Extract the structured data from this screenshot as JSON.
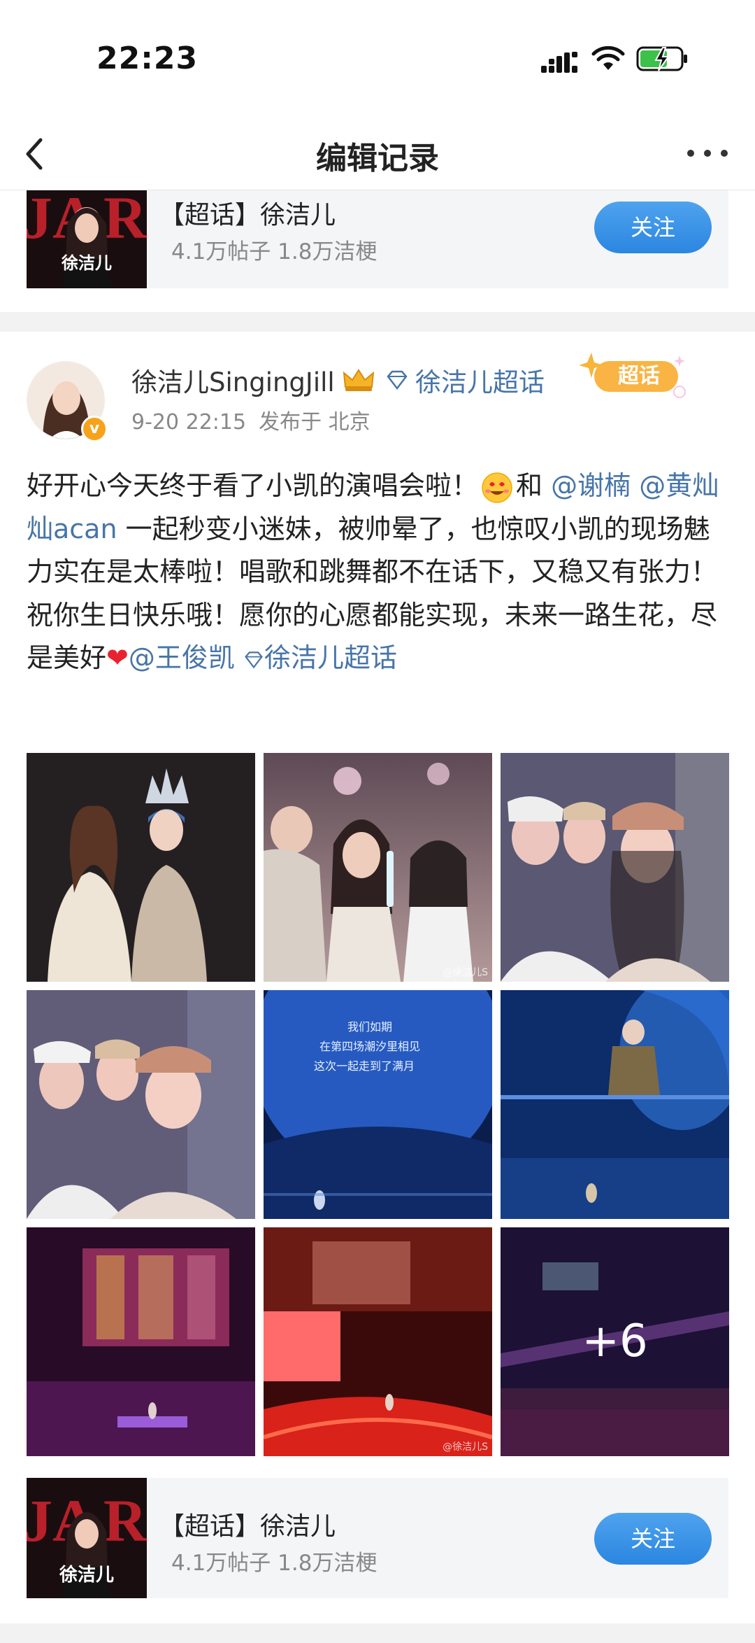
{
  "status_bar": {
    "time": "22:23"
  },
  "nav": {
    "title": "编辑记录"
  },
  "topic_card": {
    "name": "【超话】徐洁儿",
    "stats": "4.1万帖子 1.8万洁梗",
    "follow_label": "关注",
    "thumb_caption": "徐洁儿"
  },
  "post": {
    "author": "徐洁儿SingingJill",
    "supertopic": "徐洁儿超话",
    "badge_label": "超话",
    "time": "9-20 22:15",
    "location": "发布于 北京",
    "verified_mark": "v",
    "text": {
      "part1": "好开心今天终于看了小凯的演唱会啦！",
      "part2": "和",
      "mention1": "@谢楠",
      "mention2": "@黄灿灿acan",
      "part3": "一起秒变小迷妹，被帅晕了，也惊叹小凯的现场魅力实在是太棒啦！唱歌和跳舞都不在话下，又稳又有张力！祝你生日快乐哦！愿你的心愿都能实现，未来一路生花，尽是美好",
      "heart": "❤",
      "mention3": "@王俊凯",
      "topic_link": "徐洁儿超话"
    },
    "more_photos": "+6",
    "watermark": "@徐洁儿S"
  },
  "colors": {
    "link": "#4775a8",
    "follow_button": "#2c86e0",
    "badge": "#f7a21b"
  }
}
